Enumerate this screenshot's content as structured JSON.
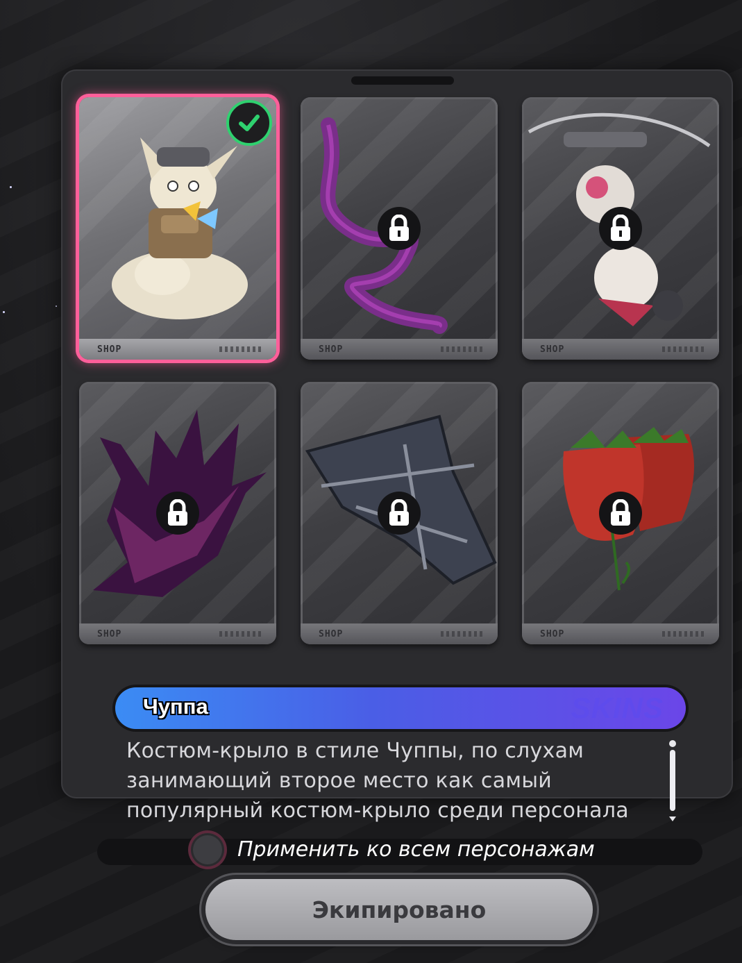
{
  "skins": [
    {
      "id": "chuppa-suit",
      "state": "equipped",
      "icon": "check-circle-icon",
      "shop_logo": "SHOP"
    },
    {
      "id": "ribbon",
      "state": "locked",
      "icon": "lock-icon",
      "shop_logo": "SHOP"
    },
    {
      "id": "mecha-pair",
      "state": "locked",
      "icon": "lock-icon",
      "shop_logo": "SHOP"
    },
    {
      "id": "dark-flame-wing",
      "state": "locked",
      "icon": "lock-icon",
      "shop_logo": "SHOP"
    },
    {
      "id": "glider-wing",
      "state": "locked",
      "icon": "lock-icon",
      "shop_logo": "SHOP"
    },
    {
      "id": "strawberry",
      "state": "locked",
      "icon": "lock-icon",
      "shop_logo": "SHOP"
    }
  ],
  "detail": {
    "name": "Чуппа",
    "watermark": "SKINS",
    "description": "Костюм-крыло в стиле Чуппы, по слухам занимающий второе место как самый популярный костюм-крыло среди персонала"
  },
  "apply_all": {
    "label": "Применить ко всем персонажам",
    "checked": false
  },
  "equip_button": {
    "label": "Экипировано"
  },
  "colors": {
    "selected_border": "#ff5f9a",
    "check": "#2fd16f",
    "name_bar_start": "#3b8cf4",
    "name_bar_end": "#6b46e8"
  }
}
